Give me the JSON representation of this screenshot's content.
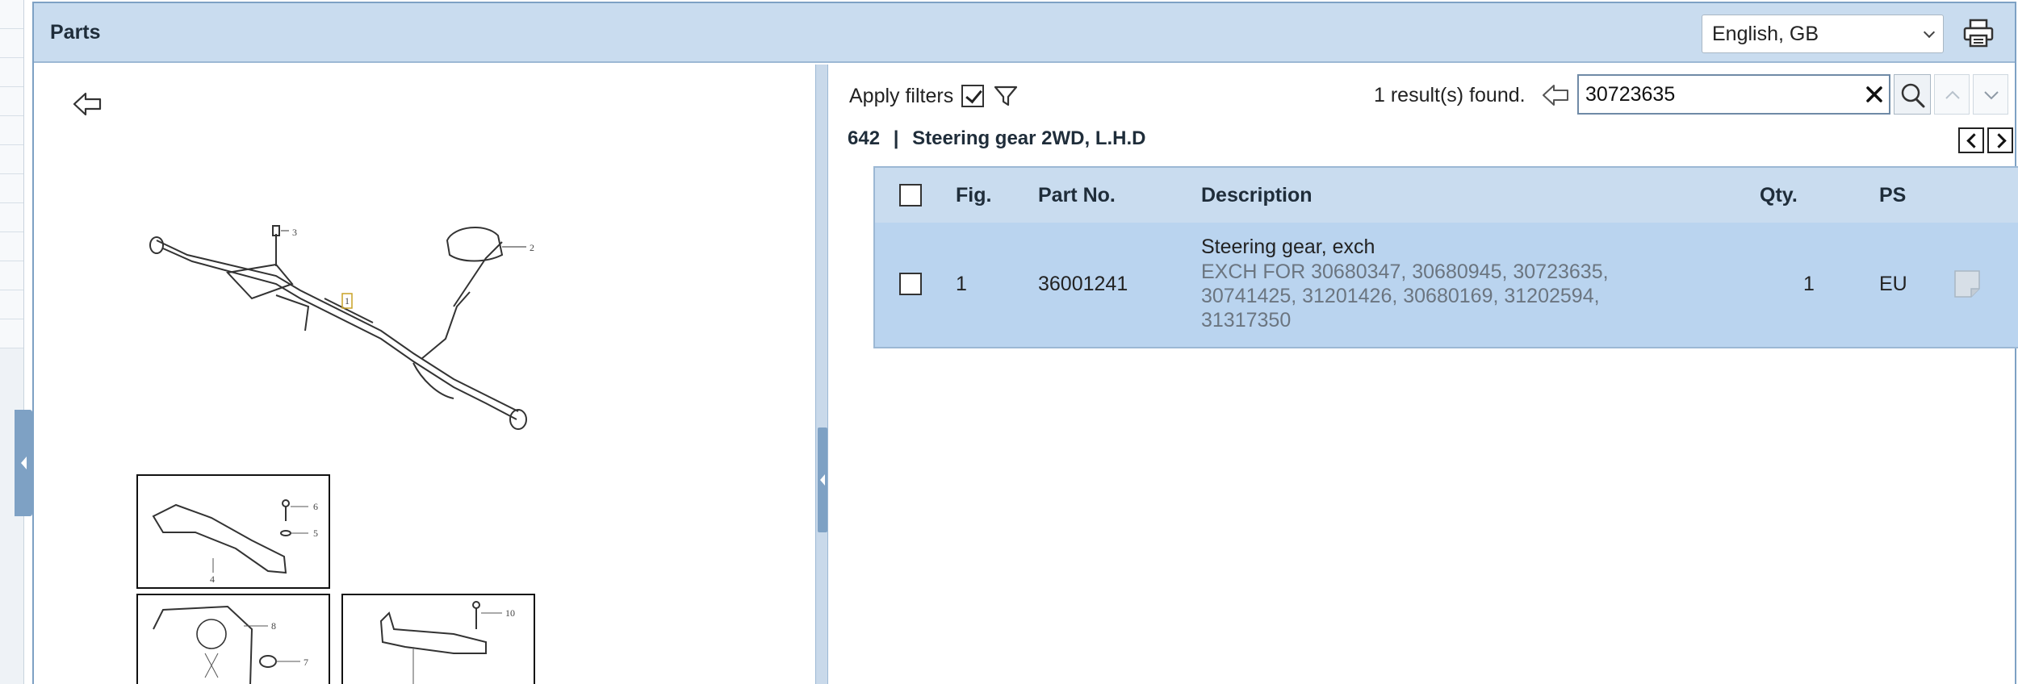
{
  "panel": {
    "title": "Parts"
  },
  "header": {
    "language": "English, GB"
  },
  "filters": {
    "label": "Apply filters",
    "checked": true
  },
  "search": {
    "result_text": "1 result(s) found.",
    "query": "30723635"
  },
  "group": {
    "number": "642",
    "separator": "|",
    "title": "Steering gear 2WD, L.H.D"
  },
  "table": {
    "columns": {
      "fig": "Fig.",
      "part_no": "Part No.",
      "description": "Description",
      "qty": "Qty.",
      "ps": "PS"
    },
    "rows": [
      {
        "fig": "1",
        "part_no": "36001241",
        "description": "Steering gear, exch",
        "note_lines": [
          "EXCH FOR 30680347, 30680945, 30723635,",
          "30741425, 31201426, 30680169, 31202594,",
          "31317350"
        ],
        "qty": "1",
        "ps": "EU"
      }
    ]
  },
  "diagram": {
    "callouts": [
      "3",
      "2",
      "1",
      "6",
      "5",
      "4",
      "8",
      "7",
      "10"
    ]
  },
  "colors": {
    "header_bg": "#c9dcef",
    "row_selected": "#bad4ef",
    "border": "#7ea1c4"
  },
  "icons": [
    "back-arrow-icon",
    "funnel-icon",
    "printer-icon",
    "search-icon",
    "close-icon",
    "chevron-up-icon",
    "chevron-down-icon",
    "note-icon"
  ]
}
